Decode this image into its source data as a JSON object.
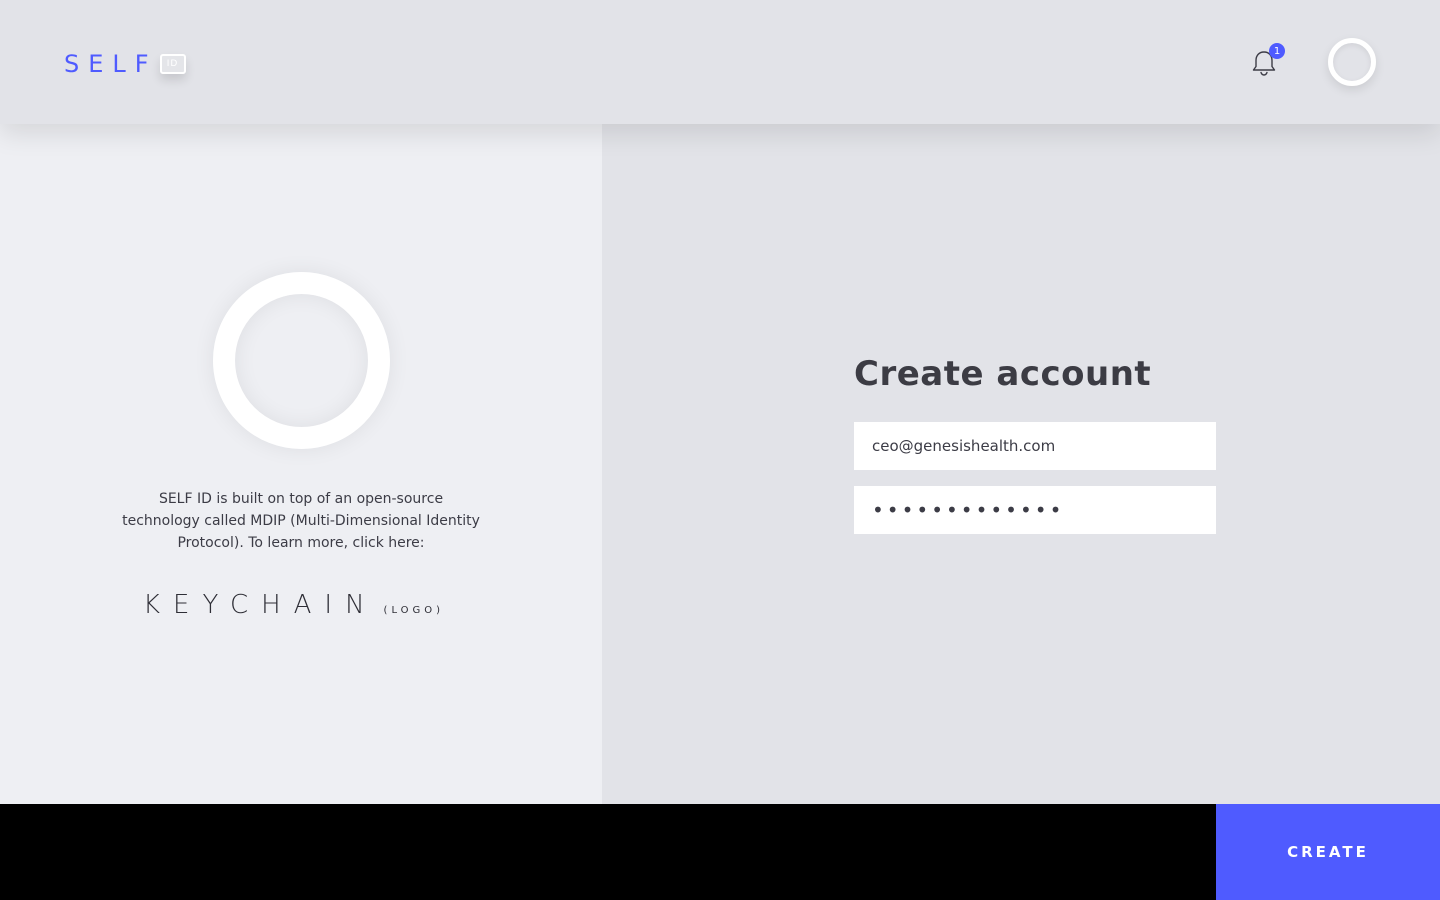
{
  "header": {
    "logo_text": "SELF",
    "logo_badge": "ID",
    "notification_count": "1",
    "bell_icon": "bell-icon"
  },
  "left_panel": {
    "info_text": "SELF ID is built on top of an open-source technology called MDIP (Multi-Dimensional Identity Protocol). To learn more, click here:",
    "keychain_label": "KEYCHAIN",
    "keychain_tag": "(LOGO)"
  },
  "form": {
    "title": "Create account",
    "email_value": "ceo@genesishealth.com",
    "password_value": "•••••••••••••"
  },
  "footer": {
    "create_label": "CREATE"
  },
  "colors": {
    "accent": "#4f5bff",
    "header_bg": "#e2e3e8",
    "left_bg": "#eeeff3",
    "footer_bg": "#000000"
  }
}
